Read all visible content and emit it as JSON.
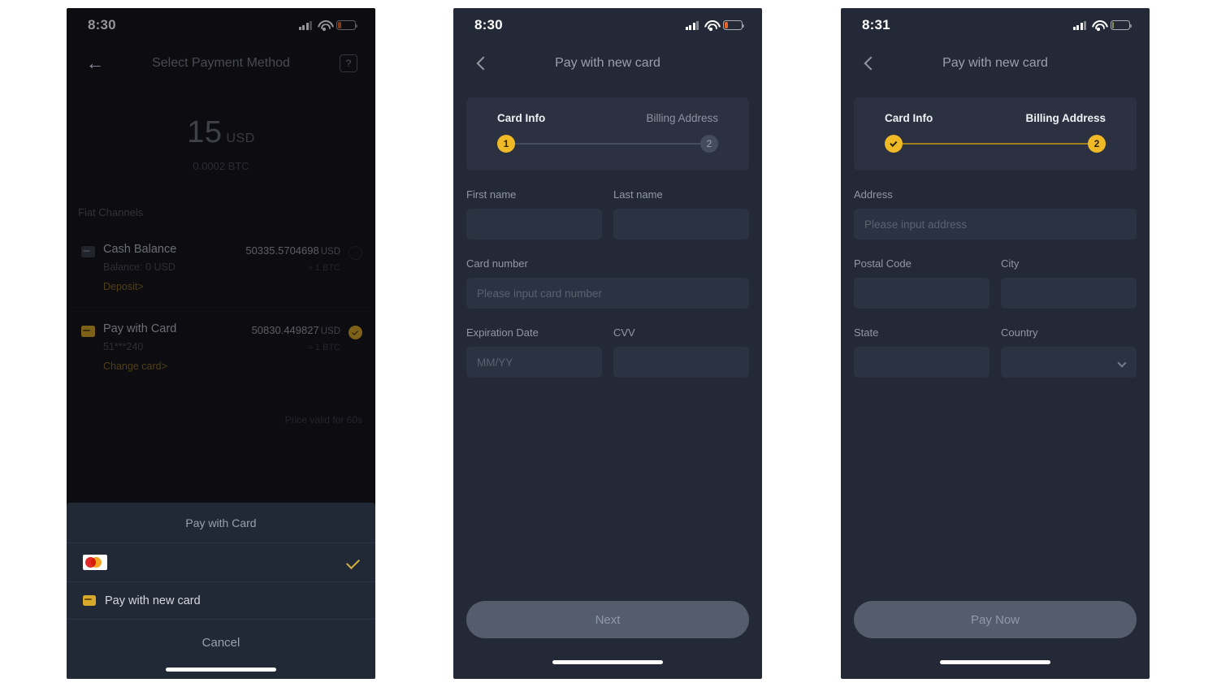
{
  "phone1": {
    "status": {
      "time": "8:30",
      "battery": "low"
    },
    "nav": {
      "title": "Select Payment Method",
      "back_icon": "arrow-left-icon",
      "help_icon": "help-icon"
    },
    "amount": {
      "value": "15",
      "currency": "USD",
      "crypto": "0.0002 BTC"
    },
    "section_label": "Fiat Channels",
    "methods": [
      {
        "icon": "card-icon-grey",
        "title": "Cash Balance",
        "subtitle": "Balance: 0 USD",
        "link": "Deposit>",
        "rate": "50335.5704698",
        "rate_currency": "USD",
        "rate_sub": "≈ 1 BTC",
        "selected": false
      },
      {
        "icon": "card-icon-gold",
        "title": "Pay with Card",
        "subtitle": "51***240",
        "link": "Change card>",
        "rate": "50830.449827",
        "rate_currency": "USD",
        "rate_sub": "≈ 1 BTC",
        "selected": true
      }
    ],
    "price_valid": "Price valid for 60s",
    "sheet": {
      "title": "Pay with Card",
      "saved_card": {
        "brand_icon": "mastercard-icon",
        "selected": true
      },
      "new_card": {
        "icon": "card-icon-gold",
        "label": "Pay with new card"
      },
      "cancel": "Cancel"
    }
  },
  "phone2": {
    "status": {
      "time": "8:30",
      "battery": "low"
    },
    "nav": {
      "title": "Pay with new card",
      "back_icon": "chevron-left-icon"
    },
    "stepper": {
      "step1_label": "Card Info",
      "step2_label": "Billing Address",
      "step1_marker": "1",
      "step2_marker": "2",
      "step1_done": false,
      "step2_active": false
    },
    "fields": {
      "first_name_label": "First name",
      "first_name_value": "",
      "first_name_placeholder": "",
      "last_name_label": "Last name",
      "last_name_value": "",
      "last_name_placeholder": "",
      "card_number_label": "Card number",
      "card_number_placeholder": "Please input card number",
      "expiration_label": "Expiration Date",
      "expiration_placeholder": "MM/YY",
      "cvv_label": "CVV",
      "cvv_placeholder": ""
    },
    "cta": "Next"
  },
  "phone3": {
    "status": {
      "time": "8:31",
      "battery": "empty"
    },
    "nav": {
      "title": "Pay with new card",
      "back_icon": "chevron-left-icon"
    },
    "stepper": {
      "step1_label": "Card Info",
      "step2_label": "Billing Address",
      "step1_marker": "✓",
      "step2_marker": "2",
      "step1_done": true,
      "step2_active": true
    },
    "fields": {
      "address_label": "Address",
      "address_placeholder": "Please input address",
      "postal_label": "Postal Code",
      "postal_placeholder": "",
      "city_label": "City",
      "city_placeholder": "",
      "state_label": "State",
      "state_placeholder": "",
      "country_label": "Country",
      "country_value": "",
      "country_icon": "chevron-down-icon"
    },
    "cta": "Pay Now"
  },
  "colors": {
    "accent_gold": "#f0ba26",
    "link_gold": "#8a6f23",
    "phone1_bg": "#15151e",
    "phone23_bg": "#232936",
    "input_bg": "#2b3241",
    "card_bg": "#2b3140",
    "cta_bg": "#555d6c"
  }
}
